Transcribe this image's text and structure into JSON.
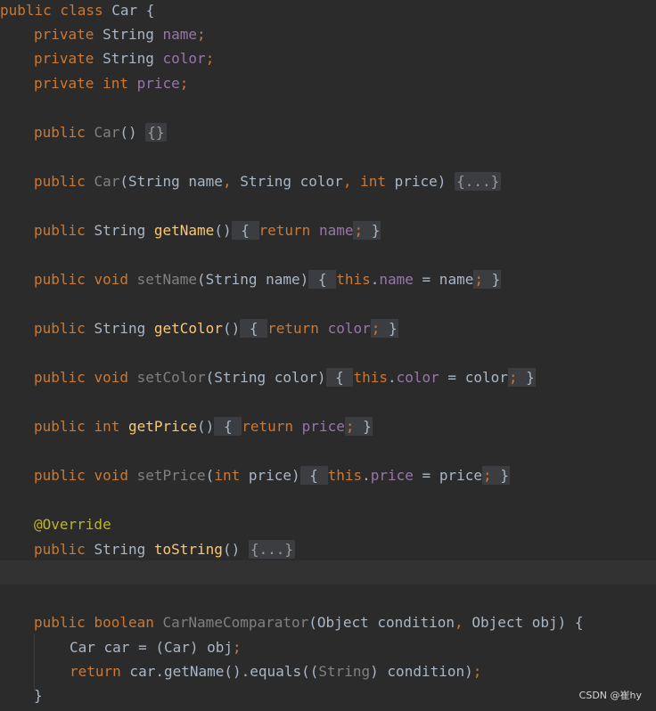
{
  "code": {
    "l1": [
      "public class Car {"
    ],
    "l2": {
      "kw": "private",
      "type": "String",
      "field": "name",
      "semi": ";"
    },
    "l3": {
      "kw": "private",
      "type": "String",
      "field": "color",
      "semi": ";"
    },
    "l4": {
      "kw": "private",
      "type": "int",
      "field": "price",
      "semi": ";"
    },
    "l5": {
      "kw": "public",
      "ctor": "Car",
      "parens": "()",
      "fold": "{}"
    },
    "l6": {
      "kw": "public",
      "ctor": "Car",
      "params": "(String name",
      "comma1": ",",
      "p2": " String color",
      "comma2": ",",
      "p3kw": " int",
      "p3": " price)",
      "fold": "{...}"
    },
    "l7": {
      "kw": "public",
      "type": "String",
      "fn": "getName",
      "parens": "()",
      "open": "{",
      "ret": "return",
      "field": "name",
      "semi": ";",
      "close": "}"
    },
    "l8": {
      "kw": "public",
      "type": "void",
      "fn": "setName",
      "params": "(String name)",
      "open": "{",
      "this": "this",
      "dot": ".",
      "field": "name",
      "assign": " = name",
      "semi": ";",
      "close": "}"
    },
    "l9": {
      "kw": "public",
      "type": "String",
      "fn": "getColor",
      "parens": "()",
      "open": "{",
      "ret": "return",
      "field": "color",
      "semi": ";",
      "close": "}"
    },
    "l10": {
      "kw": "public",
      "type": "void",
      "fn": "setColor",
      "params": "(String color)",
      "open": "{",
      "this": "this",
      "dot": ".",
      "field": "color",
      "assign": " = color",
      "semi": ";",
      "close": "}"
    },
    "l11": {
      "kw": "public",
      "type": "int",
      "fn": "getPrice",
      "parens": "()",
      "open": "{",
      "ret": "return",
      "field": "price",
      "semi": ";",
      "close": "}"
    },
    "l12": {
      "kw": "public",
      "type": "void",
      "fn": "setPrice",
      "params_open": "(",
      "pkw": "int",
      "params": " price)",
      "open": "{",
      "this": "this",
      "dot": ".",
      "field": "price",
      "assign": " = price",
      "semi": ";",
      "close": "}"
    },
    "l13": {
      "ann": "@Override"
    },
    "l14": {
      "kw": "public",
      "type": "String",
      "fn": "toString",
      "parens": "()",
      "fold": "{...}"
    },
    "l15": {
      "kw": "public",
      "type": "boolean",
      "fn": "CarNameComparator",
      "params1": "(Object condition",
      "comma": ",",
      "params2": " Object obj) {"
    },
    "l16": {
      "text1": "Car car = (Car) obj",
      "semi": ";"
    },
    "l17": {
      "ret": "return",
      "text1": " car.getName().equals((",
      "cast": "String",
      "text2": ") condition)",
      "semi": ";"
    },
    "l18": {
      "close": "}"
    }
  },
  "watermark": "CSDN @崔hy"
}
